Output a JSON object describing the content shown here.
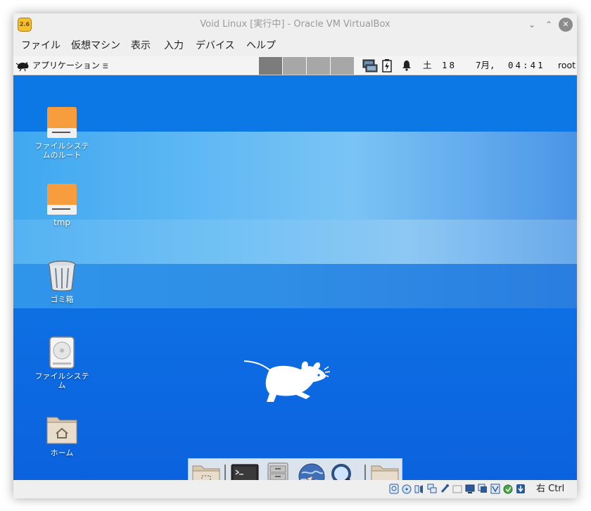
{
  "window": {
    "title": "Void Linux [実行中] - Oracle VM VirtualBox",
    "app_icon_text": "2.6",
    "buttons": {
      "minimize": "⌄",
      "maximize": "⌃",
      "close": "✕"
    }
  },
  "menubar": {
    "items": [
      "ファイル",
      "仮想マシン",
      "表示",
      "入力",
      "デバイス",
      "ヘルプ"
    ]
  },
  "xfce_panel": {
    "applications_label": "アプリケーション",
    "applications_suffix": "☰",
    "workspaces": [
      "#7c7c7c",
      "#a7a7a7",
      "#a7a7a7",
      "#a7a7a7"
    ],
    "weekday": "土",
    "day": "18",
    "month": "7月,",
    "time": "04:41",
    "user": "root"
  },
  "desktop": {
    "background_color": "#0c66e0",
    "icons": [
      {
        "name": "ファイルシステムのルート",
        "line1": "ファイルシステ",
        "line2": "ムのルート",
        "icon": "drive-orange-icon"
      },
      {
        "name": "tmp",
        "line1": "tmp",
        "line2": "",
        "icon": "drive-orange-icon"
      },
      {
        "name": "ゴミ箱",
        "line1": "ゴミ箱",
        "line2": "",
        "icon": "trash-icon"
      },
      {
        "name": "ファイルシステム",
        "line1": "ファイルシステ",
        "line2": "ム",
        "icon": "harddisk-icon"
      },
      {
        "name": "ホーム",
        "line1": "ホーム",
        "line2": "",
        "icon": "home-folder-icon"
      }
    ]
  },
  "dock": {
    "items": [
      "show-desktop-icon",
      "terminal-icon",
      "file-manager-icon",
      "web-browser-icon",
      "search-icon",
      "folder-icon"
    ]
  },
  "statusbar": {
    "icons": [
      "hard-disk-icon",
      "optical-drive-icon",
      "audio-icon",
      "network-icon",
      "usb-icon",
      "shared-folders-icon",
      "display-icon",
      "recording-icon",
      "virtualization-icon",
      "mouse-integration-icon",
      "keyboard-icon"
    ],
    "host_key": "右 Ctrl"
  }
}
